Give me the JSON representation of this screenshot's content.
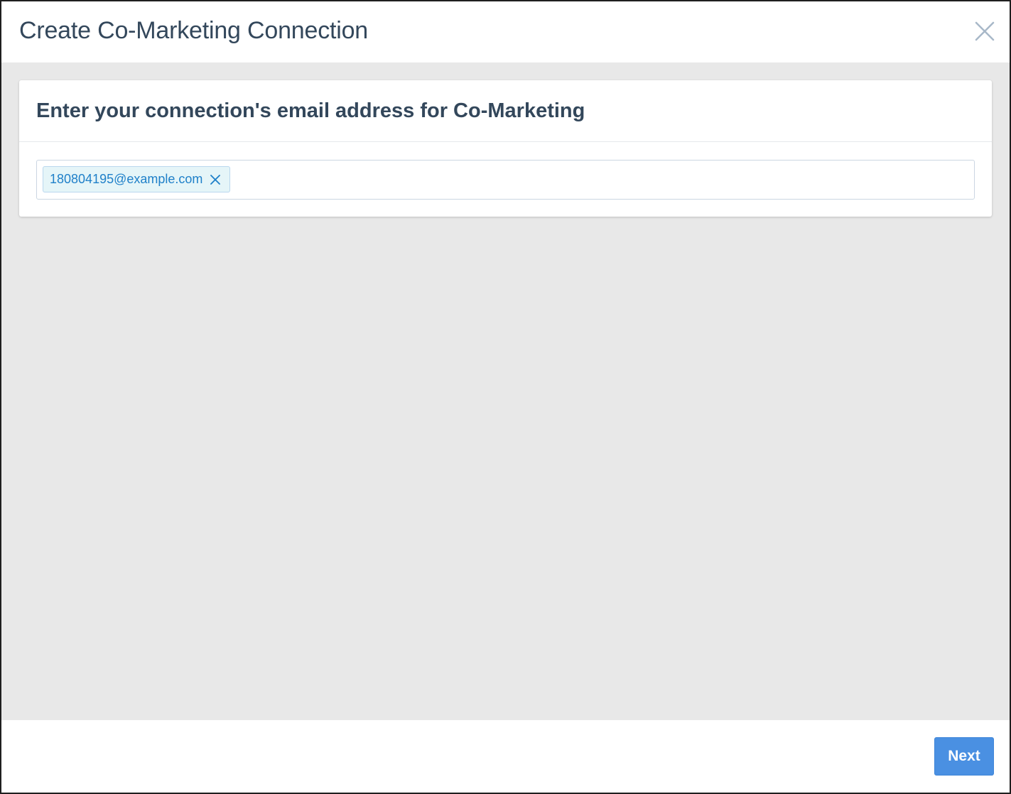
{
  "modal": {
    "title": "Create Co-Marketing Connection",
    "close_icon": "close-icon"
  },
  "card": {
    "title": "Enter your connection's email address for Co-Marketing"
  },
  "email_input": {
    "tags": [
      {
        "label": "180804195@example.com",
        "remove_icon": "close-icon"
      }
    ]
  },
  "footer": {
    "next_label": "Next"
  },
  "colors": {
    "accent": "#4a90e2",
    "tag_text": "#1f80c9",
    "tag_bg": "#e5f5f8",
    "body_bg": "#e8e8e8",
    "heading": "#33475b"
  }
}
